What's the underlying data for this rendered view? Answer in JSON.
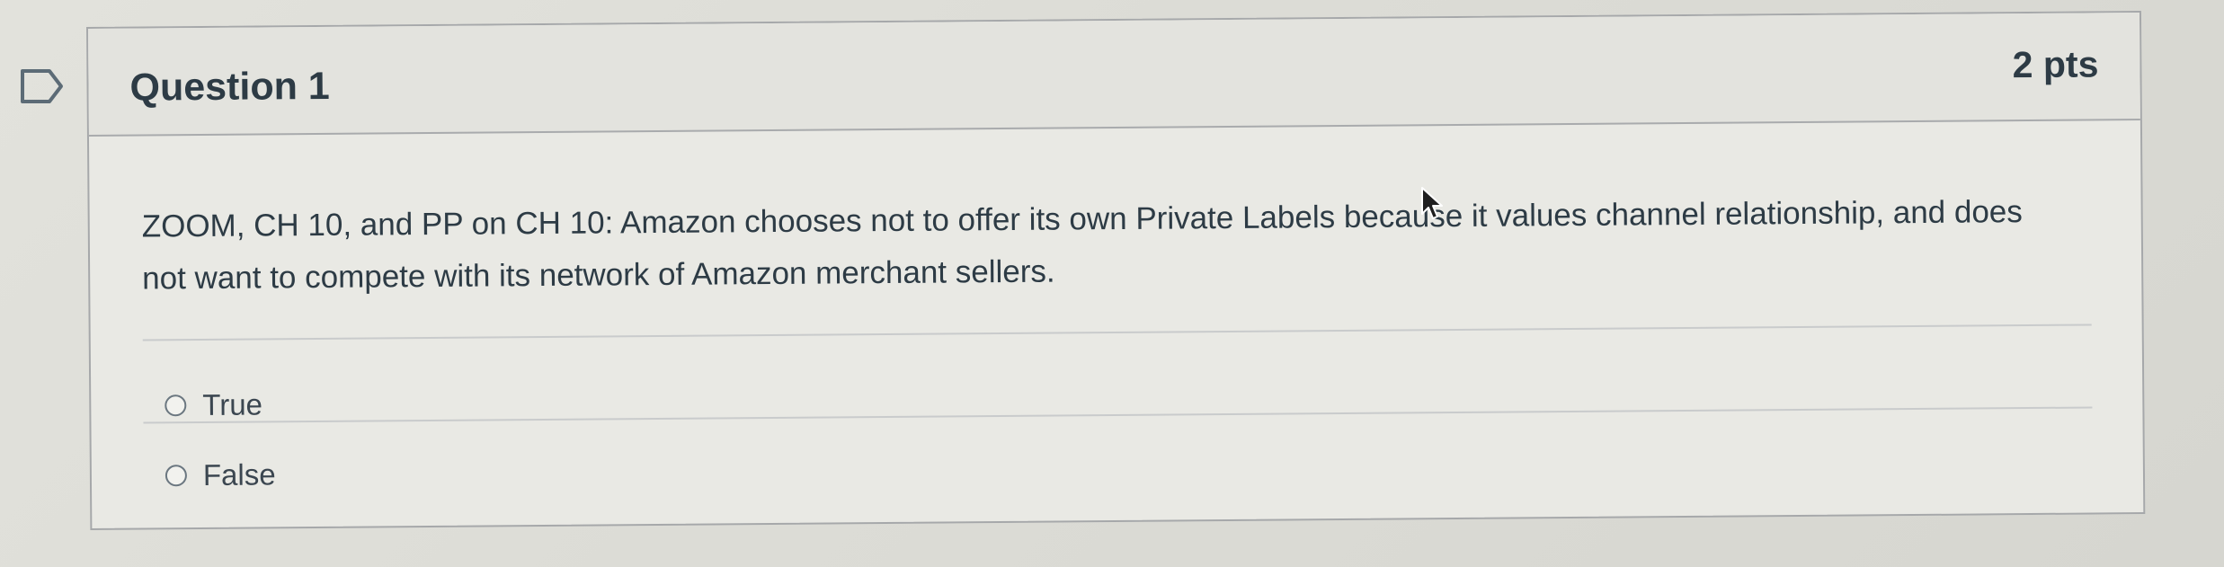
{
  "question": {
    "title": "Question 1",
    "points": "2 pts",
    "text": "ZOOM, CH 10, and PP on CH 10: Amazon chooses not to offer its own Private Labels because it values channel relationship, and does not want to compete with its network of Amazon merchant sellers.",
    "answers": [
      {
        "label": "True",
        "selected": false
      },
      {
        "label": "False",
        "selected": false
      }
    ]
  },
  "icons": {
    "flag": "bookmark-flag-icon",
    "radio": "radio-button-icon",
    "cursor": "mouse-pointer-icon"
  },
  "colors": {
    "text": "#2d3b45",
    "border": "#a6a8aa",
    "background": "#e9e9e4"
  }
}
